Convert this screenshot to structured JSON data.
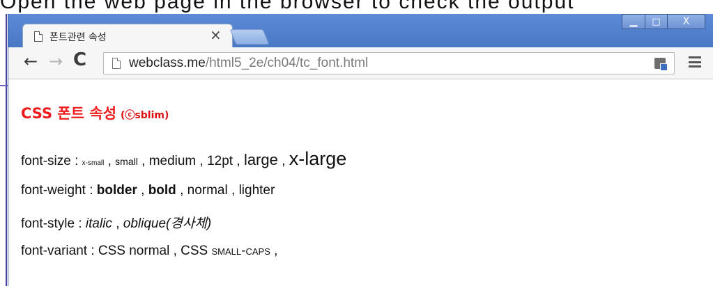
{
  "top_strip": {
    "text": "Open the web page in the browser to check the output"
  },
  "tab": {
    "title": "폰트관련 속성",
    "close": "×"
  },
  "window_controls": {
    "minimize": "▁",
    "maximize": "□",
    "close": "X"
  },
  "toolbar": {
    "back": "←",
    "forward": "→",
    "reload": "C"
  },
  "address": {
    "host": "webclass.me",
    "path": "/html5_2e/ch04/tc_font.html"
  },
  "content": {
    "heading": "CSS 폰트 속성",
    "heading_sub": "(ⓒsblim)",
    "size": {
      "label": "font-size : ",
      "xsmall": "x-small",
      "small": "small",
      "medium": "medium",
      "pt12": "12pt",
      "large": "large",
      "xlarge": "x-large",
      "sep": " , "
    },
    "weight": {
      "label": "font-weight : ",
      "bolder": "bolder",
      "bold": "bold",
      "normal": "normal",
      "lighter": "lighter",
      "sep": " , "
    },
    "style": {
      "label": "font-style : ",
      "italic": "italic",
      "oblique": "oblique(경사체)",
      "sep": " , "
    },
    "variant": {
      "label": "font-variant : ",
      "normal": "CSS normal",
      "smallcaps_prefix": "CSS ",
      "smallcaps": "small-caps",
      "sep": " , ",
      "trail": " ,"
    }
  }
}
